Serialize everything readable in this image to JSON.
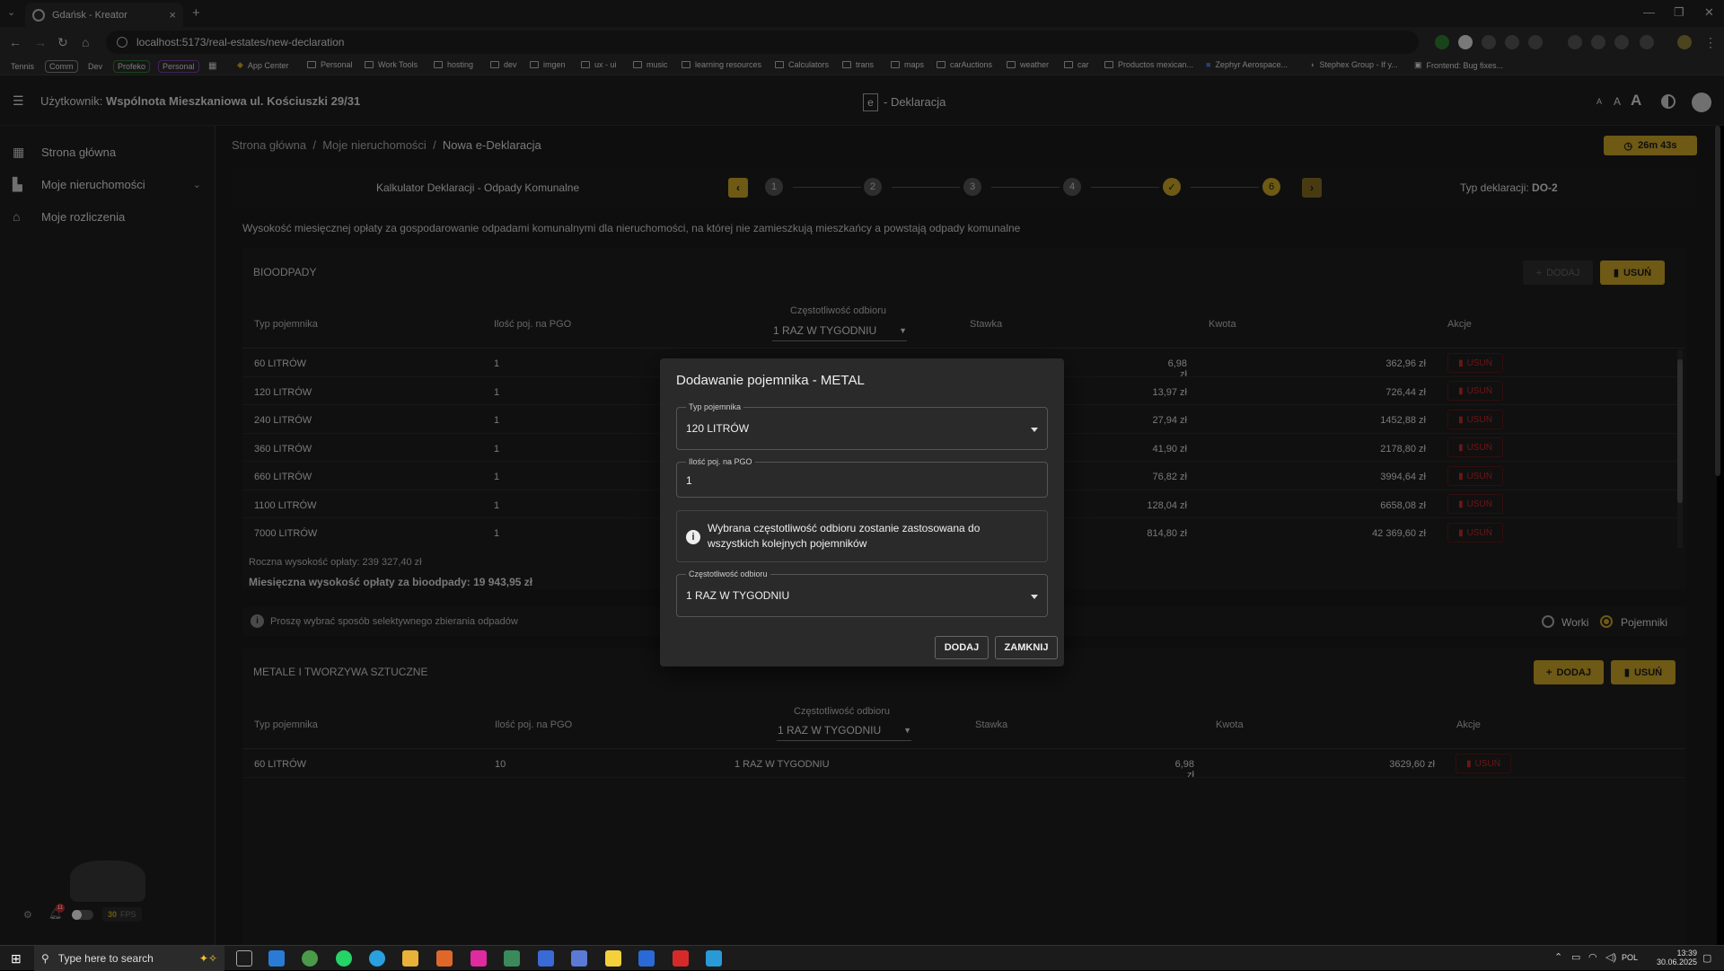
{
  "browser": {
    "tab_title": "Gdańsk - Kreator",
    "url": "localhost:5173/real-estates/new-declaration",
    "bookmarks": [
      "Tennis",
      "Comm",
      "Dev",
      "Profeko",
      "Personal",
      "App Center",
      "Personal",
      "Work Tools",
      "hosting",
      "dev",
      "imgen",
      "ux - ui",
      "music",
      "learning resources",
      "Calculators",
      "trans",
      "maps",
      "carAuctions",
      "weather",
      "car",
      "Productos mexican...",
      "Zephyr Aerospace...",
      "Stephex Group - If y...",
      "Frontend: Bug fixes..."
    ]
  },
  "header": {
    "user_label": "Użytkownik:",
    "user_name": "Wspólnota Mieszkaniowa ul. Kościuszki 29/31",
    "logo_letter": "e",
    "title": "- Deklaracja",
    "font_small": "A",
    "font_mid": "A",
    "font_large": "A"
  },
  "sidebar": {
    "items": [
      {
        "label": "Strona główna"
      },
      {
        "label": "Moje nieruchomości"
      },
      {
        "label": "Moje rozliczenia"
      }
    ],
    "fps": "30",
    "fps_label": "FPS",
    "notif_count": "11"
  },
  "breadcrumb": {
    "home": "Strona główna",
    "level2": "Moje nieruchomości",
    "current": "Nowa e-Deklaracja"
  },
  "timer": "26m 43s",
  "stepper": {
    "title": "Kalkulator Deklaracji - Odpady Komunalne",
    "steps": [
      "1",
      "2",
      "3",
      "4",
      "",
      "6"
    ],
    "declaration_type_label": "Typ deklaracji:",
    "declaration_type": "DO-2"
  },
  "description": "Wysokość miesięcznej opłaty za gospodarowanie odpadami komunalnymi dla nieruchomości, na której nie zamieszkują mieszkańcy a powstają odpady komunalne",
  "bio": {
    "title": "BIOODPADY",
    "add_label": "DODAJ",
    "delete_label": "USUŃ",
    "headers": {
      "type": "Typ pojemnika",
      "count": "Ilość poj. na PGO",
      "freq": "Częstotliwość odbioru",
      "freq_value": "1 RAZ W TYGODNIU",
      "rate": "Stawka",
      "amount": "Kwota",
      "actions": "Akcje"
    },
    "rows": [
      {
        "type": "60 LITRÓW",
        "count": "1",
        "rate": "6,98 zł",
        "amount": "362,96 zł"
      },
      {
        "type": "120 LITRÓW",
        "count": "1",
        "rate": "13,97 zł",
        "amount": "726,44 zł"
      },
      {
        "type": "240 LITRÓW",
        "count": "1",
        "rate": "27,94 zł",
        "amount": "1452,88 zł"
      },
      {
        "type": "360 LITRÓW",
        "count": "1",
        "rate": "41,90 zł",
        "amount": "2178,80 zł"
      },
      {
        "type": "660 LITRÓW",
        "count": "1",
        "rate": "76,82 zł",
        "amount": "3994,64 zł"
      },
      {
        "type": "1100 LITRÓW",
        "count": "1",
        "rate": "128,04 zł",
        "amount": "6658,08 zł"
      },
      {
        "type": "7000 LITRÓW",
        "count": "1",
        "rate": "814,80 zł",
        "amount": "42 369,60 zł"
      }
    ],
    "row_delete": "USUŃ",
    "annual": "Roczna wysokość opłaty: 239 327,40 zł",
    "monthly": "Miesięczna wysokość opłaty za bioodpady: 19 943,95 zł"
  },
  "selection": {
    "prompt": "Proszę wybrać sposób selektywnego zbierania odpadów",
    "opt_bags": "Worki",
    "opt_containers": "Pojemniki"
  },
  "metal": {
    "title": "METALE I TWORZYWA SZTUCZNE",
    "add_label": "DODAJ",
    "delete_label": "USUŃ",
    "headers": {
      "type": "Typ pojemnika",
      "count": "Ilość poj. na PGO",
      "freq": "Częstotliwość odbioru",
      "freq_value": "1 RAZ W TYGODNIU",
      "rate": "Stawka",
      "amount": "Kwota",
      "actions": "Akcje"
    },
    "rows": [
      {
        "type": "60 LITRÓW",
        "count": "10",
        "freq": "1 RAZ W TYGODNIU",
        "rate": "6,98 zł",
        "amount": "3629,60 zł"
      }
    ],
    "row_delete": "USUŃ"
  },
  "dialog": {
    "title": "Dodawanie pojemnika - METAL",
    "type_label": "Typ pojemnika",
    "type_value": "120 LITRÓW",
    "count_label": "Ilość poj. na PGO",
    "count_value": "1",
    "info": "Wybrana częstotliwość odbioru zostanie zastosowana do wszystkich kolejnych pojemników",
    "freq_label": "Częstotliwość odbioru",
    "freq_value": "1 RAZ W TYGODNIU",
    "add": "DODAJ",
    "close": "ZAMKNIJ"
  },
  "taskbar": {
    "search_placeholder": "Type here to search",
    "lang": "POL",
    "time": "13:39",
    "date": "30.06.2025"
  },
  "colors": {
    "accent": "#c9a227",
    "danger": "#c62828"
  }
}
